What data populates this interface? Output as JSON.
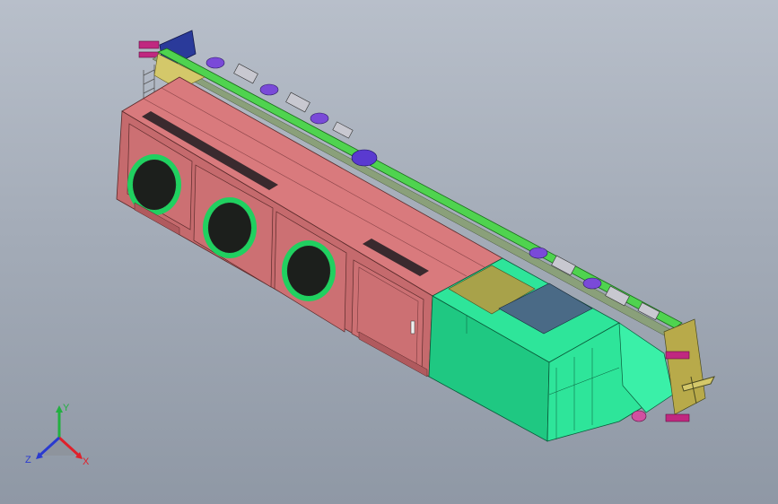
{
  "viewport": {
    "background_top": "#b8bfca",
    "background_bottom": "#8f98a5"
  },
  "model": {
    "colors": {
      "body_pink": "#d97a7d",
      "body_pink_dark": "#c56a6d",
      "cab_green": "#2ee59a",
      "cab_green_dark": "#1fc882",
      "rail_green": "#4fd34f",
      "frame_olive": "#b8aa4a",
      "cab_window": "#4a6a86",
      "fan_ring": "#20d060",
      "fan_mesh": "#1c1f1c",
      "bogie_purple": "#7a4ad8",
      "bogie_gray": "#c8c8d0",
      "buffer_magenta": "#c02880",
      "end_plate_blue": "#2a3a9a"
    },
    "fans": [
      {
        "name": "fan-1"
      },
      {
        "name": "fan-2"
      },
      {
        "name": "fan-3"
      }
    ]
  },
  "triad": {
    "x_label": "X",
    "y_label": "Y",
    "z_label": "Z",
    "x_color": "#e0202a",
    "y_color": "#22b040",
    "z_color": "#2a3ad0"
  }
}
